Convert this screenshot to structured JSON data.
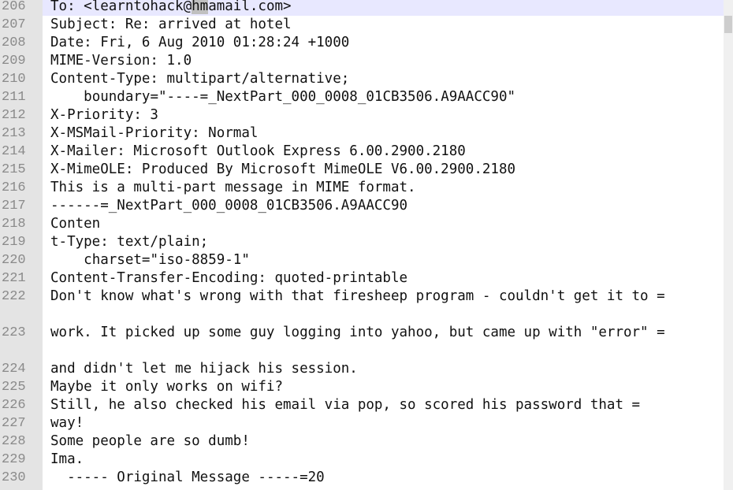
{
  "editor": {
    "lines": [
      {
        "num": "206",
        "before": "To: <learntohack@",
        "selected": "hm",
        "after": "amail.com>",
        "current": true
      },
      {
        "num": "207",
        "text": "Subject: Re: arrived at hotel"
      },
      {
        "num": "208",
        "text": "Date: Fri, 6 Aug 2010 01:28:24 +1000"
      },
      {
        "num": "209",
        "text": "MIME-Version: 1.0"
      },
      {
        "num": "210",
        "text": "Content-Type: multipart/alternative;"
      },
      {
        "num": "211",
        "text": "    boundary=\"----=_NextPart_000_0008_01CB3506.A9AACC90\""
      },
      {
        "num": "212",
        "text": "X-Priority: 3"
      },
      {
        "num": "213",
        "text": "X-MSMail-Priority: Normal"
      },
      {
        "num": "214",
        "text": "X-Mailer: Microsoft Outlook Express 6.00.2900.2180"
      },
      {
        "num": "215",
        "text": "X-MimeOLE: Produced By Microsoft MimeOLE V6.00.2900.2180"
      },
      {
        "num": "216",
        "text": "This is a multi-part message in MIME format."
      },
      {
        "num": "217",
        "text": "------=_NextPart_000_0008_01CB3506.A9AACC90"
      },
      {
        "num": "218",
        "text": "Conten"
      },
      {
        "num": "219",
        "text": "t-Type: text/plain;"
      },
      {
        "num": "220",
        "text": "    charset=\"iso-8859-1\""
      },
      {
        "num": "221",
        "text": "Content-Transfer-Encoding: quoted-printable"
      },
      {
        "num": "222",
        "text": "Don't know what's wrong with that firesheep program - couldn't get it to =",
        "wrap": true
      },
      {
        "num": "223",
        "text": "work. It picked up some guy logging into yahoo, but came up with \"error\" =",
        "wrap": true
      },
      {
        "num": "224",
        "text": "and didn't let me hijack his session."
      },
      {
        "num": "225",
        "text": "Maybe it only works on wifi?"
      },
      {
        "num": "226",
        "text": "Still, he also checked his email via pop, so scored his password that ="
      },
      {
        "num": "227",
        "text": "way!"
      },
      {
        "num": "228",
        "text": "Some people are so dumb!"
      },
      {
        "num": "229",
        "text": "Ima."
      },
      {
        "num": "230",
        "text": "  ----- Original Message -----=20"
      }
    ]
  }
}
